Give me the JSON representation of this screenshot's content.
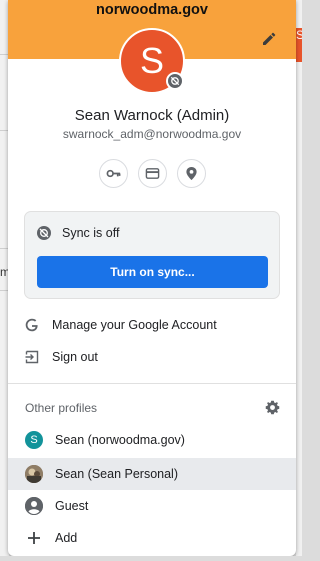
{
  "header": {
    "org": "norwoodma.gov",
    "band_color": "#f8a23c",
    "edit_icon": "pencil-icon"
  },
  "account": {
    "avatar_letter": "S",
    "avatar_color": "#e8542b",
    "name": "Sean Warnock (Admin)",
    "email": "swarnock_adm@norwoodma.gov",
    "quick_icons": [
      "key-icon",
      "credit-card-icon",
      "location-pin-icon"
    ]
  },
  "sync": {
    "status": "Sync is off",
    "button_label": "Turn on sync...",
    "button_color": "#1a73e8"
  },
  "menu": {
    "manage_account": "Manage your Google Account",
    "sign_out": "Sign out"
  },
  "other_profiles": {
    "label": "Other profiles",
    "profiles": [
      {
        "name": "Sean (norwoodma.gov)",
        "avatar_letter": "S",
        "avatar_color": "#12939a"
      },
      {
        "name": "Sean (Sean Personal)",
        "avatar": "photo-avatar"
      }
    ],
    "guest": "Guest",
    "add": "Add"
  },
  "background": {
    "left_letter": "m",
    "right_letter": "S"
  }
}
